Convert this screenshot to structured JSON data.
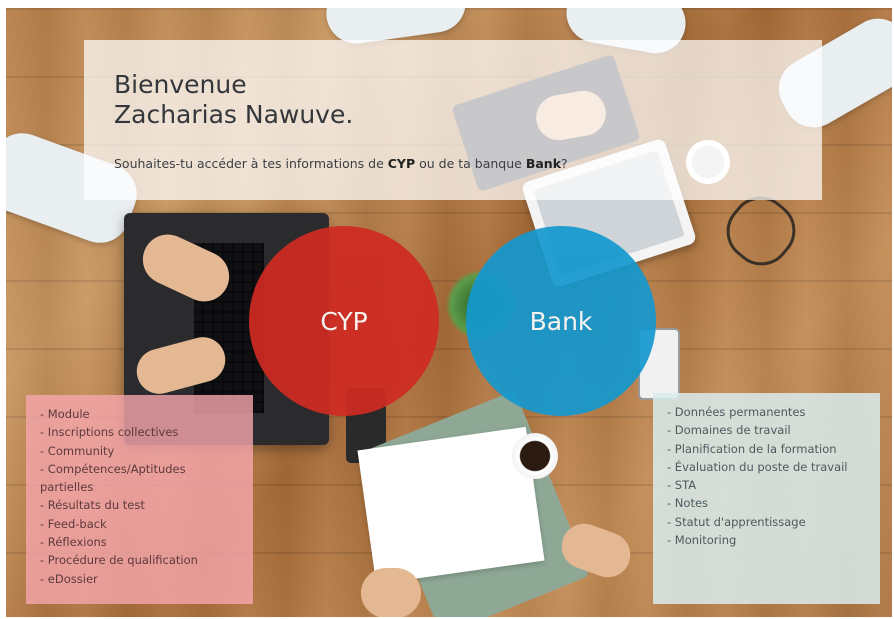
{
  "welcome": {
    "line1": "Bienvenue",
    "line2": "Zacharias Nawuve.",
    "question_prefix": "Souhaites-tu accéder à tes informations de ",
    "question_cyp": "CYP",
    "question_mid": " ou de ta banque ",
    "question_bank": "Bank",
    "question_suffix": "?"
  },
  "choices": {
    "cyp_label": "CYP",
    "bank_label": "Bank"
  },
  "colors": {
    "cyp": "#cf2a22",
    "bank": "#1498cf"
  },
  "cyp_list": [
    "- Module",
    "- Inscriptions collectives",
    "- Community",
    "- Compétences/Aptitudes partielles",
    "- Résultats du test",
    "- Feed-back",
    "- Réflexions",
    "- Procédure de qualification",
    "- eDossier"
  ],
  "bank_list": [
    "- Données permanentes",
    "- Domaines de travail",
    "- Planification de la formation",
    "- Évaluation du poste de travail",
    "- STA",
    "- Notes",
    "- Statut d'apprentissage",
    "- Monitoring"
  ]
}
